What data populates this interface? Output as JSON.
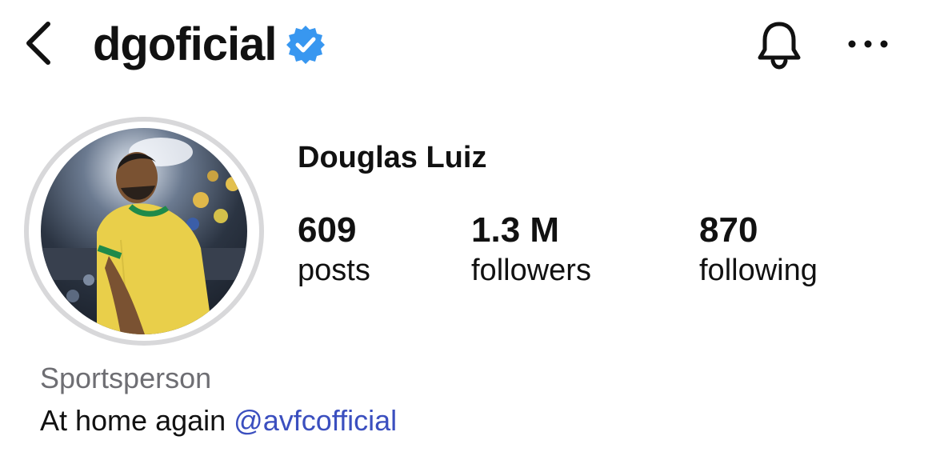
{
  "header": {
    "username": "dgoficial",
    "verified": true,
    "icons": {
      "back": "chevron-left-icon",
      "verified": "verified-badge-icon",
      "notifications": "bell-icon",
      "more": "more-horizontal-icon"
    }
  },
  "profile": {
    "display_name": "Douglas Luiz",
    "stats": {
      "posts": {
        "value": "609",
        "label": "posts"
      },
      "followers": {
        "value": "1.3 M",
        "label": "followers"
      },
      "following": {
        "value": "870",
        "label": "following"
      }
    },
    "category": "Sportsperson",
    "bio": {
      "text": "At home again ",
      "mention": "@avfcofficial"
    }
  },
  "colors": {
    "verified_blue": "#3897f0",
    "mention": "#3b4fbf",
    "muted_text": "#6e6e73",
    "avatar_ring": "#d8d8da"
  }
}
